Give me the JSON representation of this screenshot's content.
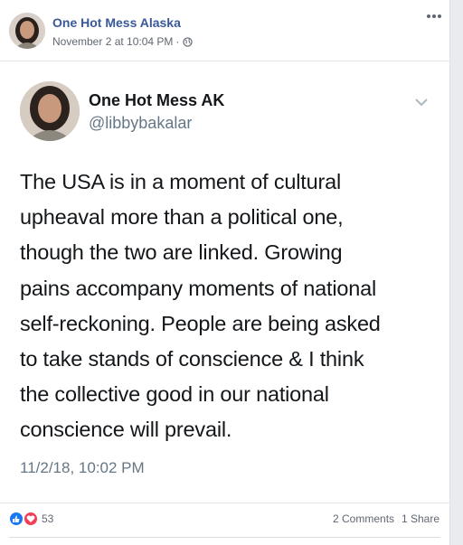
{
  "post": {
    "page_name": "One Hot Mess Alaska",
    "timestamp": "November 2 at 10:04 PM",
    "privacy_separator": "·",
    "privacy_icon": "globe-icon",
    "more_icon": "more-options-icon"
  },
  "tweet": {
    "display_name": "One Hot Mess AK",
    "handle": "@libbybakalar",
    "text_lines": [
      "The USA is in a moment of cultural",
      "upheaval more than a political one,",
      "though the two are linked. Growing",
      "pains accompany moments of national",
      "self-reckoning. People are being asked",
      "to take stands of conscience & I think",
      "the collective good in our national",
      "conscience will prevail."
    ],
    "time": "11/2/18, 10:02 PM"
  },
  "footer": {
    "reaction_count": "53",
    "comments": "2 Comments",
    "shares": "1 Share"
  },
  "colors": {
    "link_blue": "#385898",
    "like_blue": "#1877f2",
    "love_red": "#f33e58",
    "meta_gray": "#606770"
  }
}
